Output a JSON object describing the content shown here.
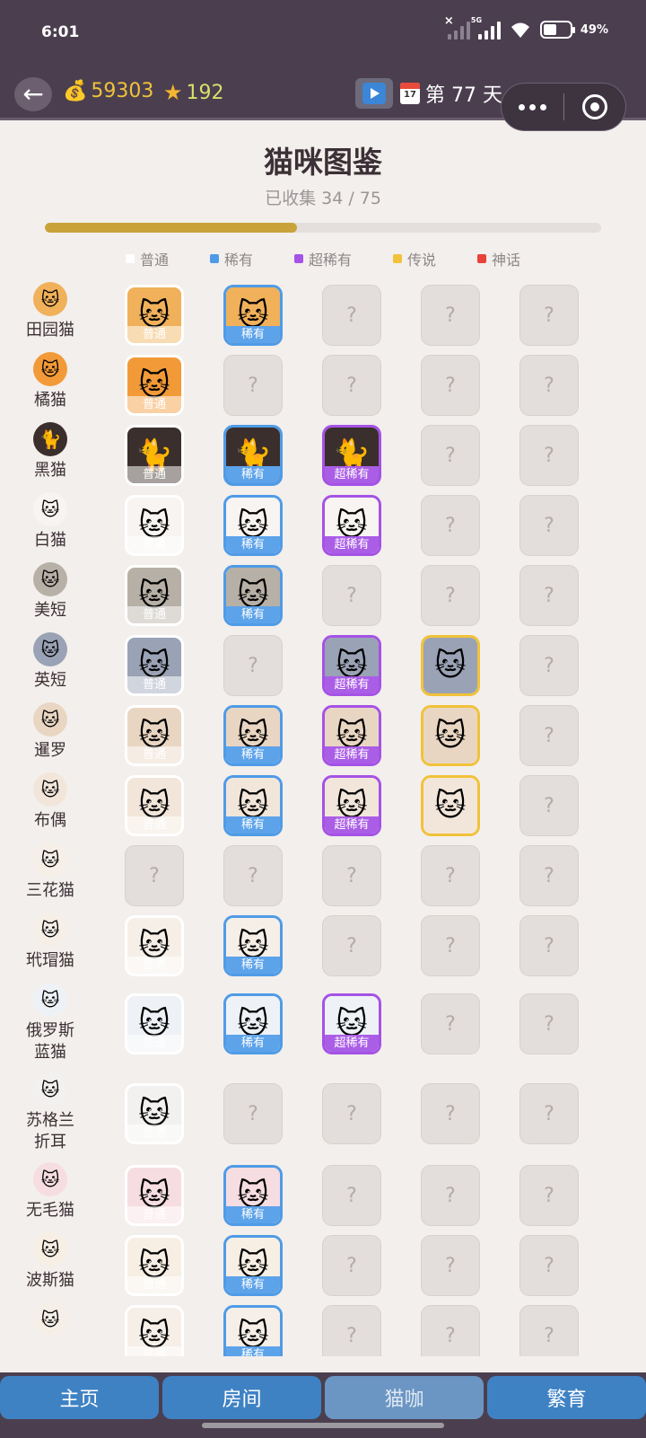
{
  "status": {
    "time": "6:01",
    "network": "5G",
    "battery": "49%"
  },
  "header": {
    "coins": "59303",
    "stars": "192",
    "day_text": "第 77 天",
    "calendar_day": "17"
  },
  "page": {
    "title": "猫咪图鉴",
    "collected_text": "已收集 34 / 75",
    "progress_fraction": 0.453
  },
  "legend": [
    {
      "label": "普通",
      "color": "#ffffff"
    },
    {
      "label": "稀有",
      "color": "#4f9be7"
    },
    {
      "label": "超稀有",
      "color": "#a552e6"
    },
    {
      "label": "传说",
      "color": "#f1c23a"
    },
    {
      "label": "神话",
      "color": "#e8423a"
    }
  ],
  "rarity_labels": {
    "normal": "普通",
    "rare": "稀有",
    "super": "超稀有",
    "legend": "传说",
    "myth": "神话"
  },
  "locked_symbol": "?",
  "cats": [
    {
      "name": "田园猫",
      "icon": "tabby-orange-cat",
      "bg": "#f0b15a",
      "cells": [
        "normal",
        "rare",
        "locked",
        "locked",
        "locked"
      ]
    },
    {
      "name": "橘猫",
      "icon": "orange-cat",
      "bg": "#f29a38",
      "cells": [
        "normal",
        "locked",
        "locked",
        "locked",
        "locked"
      ]
    },
    {
      "name": "黑猫",
      "icon": "black-cat",
      "bg": "#3a2f2c",
      "cells": [
        "normal",
        "rare",
        "super",
        "locked",
        "locked"
      ]
    },
    {
      "name": "白猫",
      "icon": "white-cat",
      "bg": "#f7f4f1",
      "cells": [
        "normal",
        "rare",
        "super",
        "locked",
        "locked"
      ]
    },
    {
      "name": "美短",
      "icon": "american-shorthair-cat",
      "bg": "#b7b0a6",
      "cells": [
        "normal",
        "rare",
        "locked",
        "locked",
        "locked"
      ]
    },
    {
      "name": "英短",
      "icon": "british-shorthair-cat",
      "bg": "#9aa2b5",
      "cells": [
        "normal",
        "locked",
        "super",
        "legend",
        "locked"
      ]
    },
    {
      "name": "暹罗",
      "icon": "siamese-cat",
      "bg": "#e9d6c2",
      "cells": [
        "normal",
        "rare",
        "super",
        "legend",
        "locked"
      ]
    },
    {
      "name": "布偶",
      "icon": "ragdoll-cat",
      "bg": "#f2e6da",
      "cells": [
        "normal",
        "rare",
        "super",
        "legend",
        "locked"
      ]
    },
    {
      "name": "三花猫",
      "icon": "calico-cat",
      "bg": "#f5efe8",
      "cells": [
        "locked",
        "locked",
        "locked",
        "locked",
        "locked"
      ]
    },
    {
      "name": "玳瑁猫",
      "icon": "tortoiseshell-cat",
      "bg": "#f5efe8",
      "cells": [
        "normal",
        "rare",
        "locked",
        "locked",
        "locked"
      ]
    },
    {
      "name": "俄罗斯\n蓝猫",
      "icon": "russian-blue-cat",
      "bg": "#eef2f6",
      "cells": [
        "normal",
        "rare",
        "super",
        "locked",
        "locked"
      ]
    },
    {
      "name": "苏格兰\n折耳",
      "icon": "scottish-fold-cat",
      "bg": "#f2f1f0",
      "cells": [
        "normal",
        "locked",
        "locked",
        "locked",
        "locked"
      ]
    },
    {
      "name": "无毛猫",
      "icon": "sphynx-cat",
      "bg": "#f6dde2",
      "cells": [
        "normal",
        "rare",
        "locked",
        "locked",
        "locked"
      ]
    },
    {
      "name": "波斯猫",
      "icon": "persian-cat",
      "bg": "#f7efe4",
      "cells": [
        "normal",
        "rare",
        "locked",
        "locked",
        "locked"
      ]
    },
    {
      "name": "",
      "icon": "maine-coon-cat",
      "bg": "#f5efe8",
      "cells": [
        "normal",
        "rare",
        "locked",
        "locked",
        "locked"
      ]
    }
  ],
  "nav": [
    {
      "label": "主页",
      "active": false
    },
    {
      "label": "房间",
      "active": false
    },
    {
      "label": "猫咖",
      "active": true
    },
    {
      "label": "繁育",
      "active": false
    }
  ]
}
